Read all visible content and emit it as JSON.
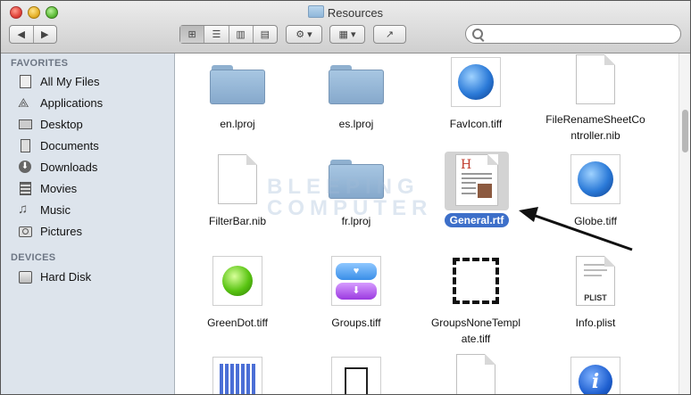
{
  "window": {
    "title": "Resources"
  },
  "toolbar": {
    "back": "◀",
    "forward": "▶",
    "views": [
      "⊞",
      "☰",
      "▥",
      "▤"
    ],
    "action": "⚙ ▾",
    "arrange": "▦ ▾",
    "share": "↗"
  },
  "search": {
    "placeholder": ""
  },
  "sidebar": {
    "favorites_header": "FAVORITES",
    "favorites": [
      "All My Files",
      "Applications",
      "Desktop",
      "Documents",
      "Downloads",
      "Movies",
      "Music",
      "Pictures"
    ],
    "devices_header": "DEVICES",
    "devices": [
      "Hard Disk"
    ]
  },
  "files": [
    {
      "name": "en.lproj",
      "icon": "folder-icon"
    },
    {
      "name": "es.lproj",
      "icon": "folder-icon"
    },
    {
      "name": "FavIcon.tiff",
      "icon": "globe-icon"
    },
    {
      "name": "FileRenameSheetCo ntroller.nib",
      "icon": "document-icon"
    },
    {
      "name": "FilterBar.nib",
      "icon": "document-icon"
    },
    {
      "name": "fr.lproj",
      "icon": "folder-icon"
    },
    {
      "name": "General.rtf",
      "icon": "rtf-document-icon",
      "selected": true
    },
    {
      "name": "Globe.tiff",
      "icon": "globe-icon"
    },
    {
      "name": "GreenDot.tiff",
      "icon": "green-dot-icon"
    },
    {
      "name": "Groups.tiff",
      "icon": "groups-icon"
    },
    {
      "name": "GroupsNoneTempl ate.tiff",
      "icon": "dashed-square-icon"
    },
    {
      "name": "Info.plist",
      "icon": "plist-icon"
    }
  ],
  "watermark": [
    "BLEEPING",
    "COMPUTER"
  ],
  "plist_label": "PLIST",
  "info_glyph": "i"
}
